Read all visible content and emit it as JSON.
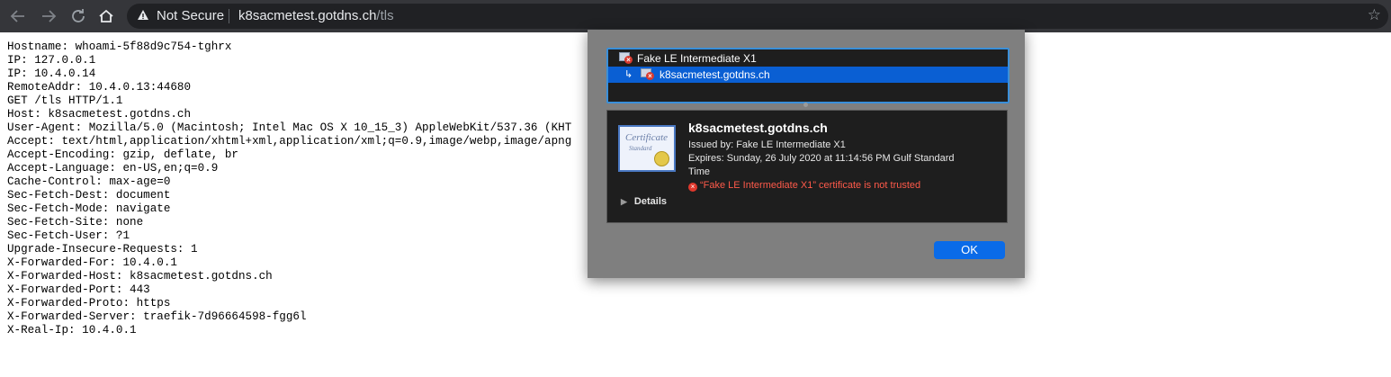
{
  "browser": {
    "security_label": "Not Secure",
    "url_host": "k8sacmetest.gotdns.ch",
    "url_path": "/tls",
    "icons": {
      "back": "back-arrow-icon",
      "forward": "forward-arrow-icon",
      "reload": "reload-icon",
      "home": "home-icon",
      "warning": "warning-triangle-icon",
      "bookmark": "star-icon"
    }
  },
  "page": {
    "lines": [
      "Hostname: whoami-5f88d9c754-tghrx",
      "IP: 127.0.0.1",
      "IP: 10.4.0.14",
      "RemoteAddr: 10.4.0.13:44680",
      "GET /tls HTTP/1.1",
      "Host: k8sacmetest.gotdns.ch",
      "User-Agent: Mozilla/5.0 (Macintosh; Intel Mac OS X 10_15_3) AppleWebKit/537.36 (KHT",
      "Accept: text/html,application/xhtml+xml,application/xml;q=0.9,image/webp,image/apng",
      "Accept-Encoding: gzip, deflate, br",
      "Accept-Language: en-US,en;q=0.9",
      "Cache-Control: max-age=0",
      "Sec-Fetch-Dest: document",
      "Sec-Fetch-Mode: navigate",
      "Sec-Fetch-Site: none",
      "Sec-Fetch-User: ?1",
      "Upgrade-Insecure-Requests: 1",
      "X-Forwarded-For: 10.4.0.1",
      "X-Forwarded-Host: k8sacmetest.gotdns.ch",
      "X-Forwarded-Port: 443",
      "X-Forwarded-Proto: https",
      "X-Forwarded-Server: traefik-7d96664598-fgg6l",
      "X-Real-Ip: 10.4.0.1"
    ]
  },
  "cert_dialog": {
    "chain": [
      {
        "label": "Fake LE Intermediate X1",
        "selected": false
      },
      {
        "label": "k8sacmetest.gotdns.ch",
        "selected": true
      }
    ],
    "detail": {
      "icon_word": "Certificate",
      "icon_sub": "Standard",
      "title": "k8sacmetest.gotdns.ch",
      "issued_by": "Issued by: Fake LE Intermediate X1",
      "expires": "Expires: Sunday, 26 July 2020 at 11:14:56 PM Gulf Standard Time",
      "error": "“Fake LE Intermediate X1” certificate is not trusted",
      "details_label": "Details"
    },
    "ok_label": "OK",
    "colors": {
      "selection": "#0a5fd3",
      "error_text": "#ff5a4a",
      "ok_button": "#0a6be8"
    }
  }
}
